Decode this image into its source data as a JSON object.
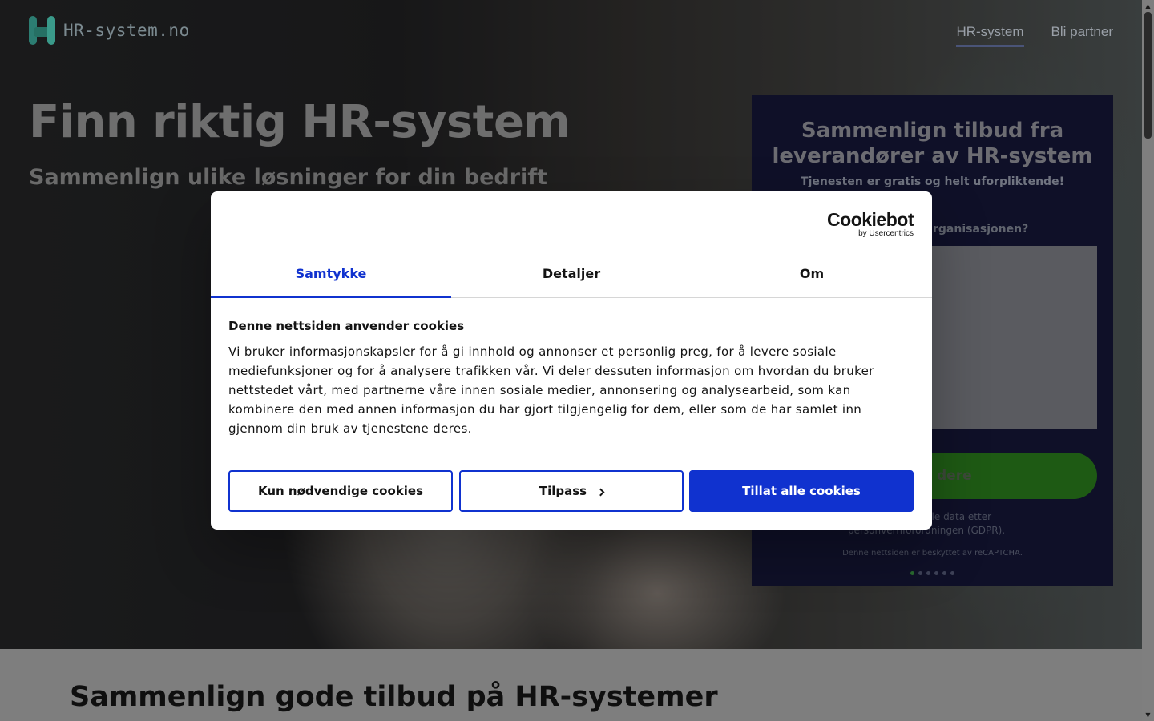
{
  "site": {
    "logo_text": "HR-system.no",
    "nav": [
      {
        "label": "HR-system",
        "active": true
      },
      {
        "label": "Bli partner",
        "active": false
      }
    ]
  },
  "hero": {
    "title": "Finn riktig HR-system",
    "subtitle": "Sammenlign ulike løsninger for din bedrift"
  },
  "quote_panel": {
    "title": "Sammenlign tilbud fra leverandører av HR-system",
    "subtitle": "Tjenesten er gratis og helt uforpliktende!",
    "question_partial": "rganisasjonen?",
    "button_partial": "dere",
    "privacy_partial": "s; Vi behandler alle data etter personvernforordningen (GDPR).",
    "captcha_note": "Denne nettsiden er beskyttet av reCAPTCHA.",
    "step_total": 6,
    "step_current": 1
  },
  "section": {
    "title": "Sammenlign gode tilbud på HR-systemer"
  },
  "cookie_dialog": {
    "brand": "Cookiebot",
    "brand_sub": "by Usercentrics",
    "tabs": [
      {
        "label": "Samtykke",
        "active": true
      },
      {
        "label": "Detaljer",
        "active": false
      },
      {
        "label": "Om",
        "active": false
      }
    ],
    "heading": "Denne nettsiden anvender cookies",
    "body": "Vi bruker informasjonskapsler for å gi innhold og annonser et personlig preg, for å levere sosiale mediefunksjoner og for å analysere trafikken vår. Vi deler dessuten informasjon om hvordan du bruker nettstedet vårt, med partnerne våre innen sosiale medier, annonsering og analysearbeid, som kan kombinere den med annen informasjon du har gjort tilgjengelig for dem, eller som de har samlet inn gjennom din bruk av tjenestene deres.",
    "buttons": {
      "necessary": "Kun nødvendige cookies",
      "customize": "Tilpass",
      "allow_all": "Tillat alle cookies"
    }
  },
  "colors": {
    "accent": "#1032cf",
    "panel_bg": "#0f1028",
    "cta_green": "#1e5a14"
  }
}
